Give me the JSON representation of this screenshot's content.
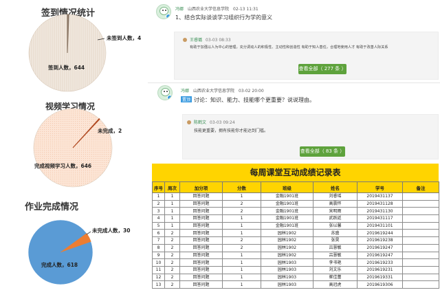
{
  "stats": {
    "sign_in": {
      "title": "签到情况统计",
      "signed_label": "签到人数，644",
      "unsigned_label": "未签到人数，4",
      "colors": {
        "fill": "#f1e9e0",
        "slice": "#8a7766"
      }
    },
    "video": {
      "title": "视频学习情况",
      "done_label": "完成视频学习人数，646",
      "undone_label": "未完成，2",
      "colors": {
        "fill": "#fce5d6",
        "slice": "#b14a22"
      }
    },
    "homework": {
      "title": "作业完成情况",
      "done_label": "完成人数，618",
      "undone_label": "未完成人数，30",
      "colors": {
        "fill": "#5a9bd5",
        "slice": "#ed7d31"
      }
    }
  },
  "chart_data": [
    {
      "type": "pie",
      "title": "签到情况统计",
      "categories": [
        "签到人数",
        "未签到人数"
      ],
      "values": [
        644,
        4
      ]
    },
    {
      "type": "pie",
      "title": "视频学习情况",
      "categories": [
        "完成视频学习人数",
        "未完成"
      ],
      "values": [
        646,
        2
      ]
    },
    {
      "type": "pie",
      "title": "作业完成情况",
      "categories": [
        "完成人数",
        "未完成人数"
      ],
      "values": [
        618,
        30
      ]
    }
  ],
  "discussion": {
    "post1": {
      "author": "冯娜",
      "school": "山西农业大学信息学院",
      "time": "02-13 11:31",
      "question": "1、结合实际谈谈学习组织行为学的意义",
      "reply": {
        "name": "王睿璐",
        "time": "03-03 08:33",
        "text": "有助于加强以人为中心的管理，充分调动人的积极性、主动性和创造性  有助于知人善任，合理地使用人才  有助于改善人际关系"
      },
      "view_all": "查看全部（ 277 条 ）"
    },
    "post2": {
      "author": "冯娜",
      "school": "山西农业大学信息学院",
      "time": "03-02 20:00",
      "tag": "置顶",
      "question": "讨论：知识、能力、技能哪个更重要？说说理由。",
      "reply": {
        "name": "陈鹤文",
        "time": "03-03 09:24",
        "text": "技能更重要，拥有技能你才能达到门槛。"
      },
      "view_all": "查看全部（ 83 条 ）"
    }
  },
  "table": {
    "title": "每周课堂互动成绩记录表",
    "headers": [
      "序号",
      "周次",
      "加分项",
      "分数",
      "班级",
      "姓名",
      "学号",
      "备注"
    ],
    "rows": [
      [
        "1",
        "1",
        "回答问题",
        "1",
        "金融1901班",
        "刘睿瑶",
        "2019431137",
        ""
      ],
      [
        "2",
        "1",
        "回答问题",
        "2",
        "金融1901班",
        "高震怀",
        "2019431128",
        ""
      ],
      [
        "3",
        "1",
        "回答问题",
        "2",
        "金融1901班",
        "宋明雨",
        "2019431130",
        ""
      ],
      [
        "4",
        "1",
        "回答问题",
        "1",
        "金融1901班",
        "武跃廷",
        "2019431117",
        ""
      ],
      [
        "5",
        "1",
        "回答问题",
        "1",
        "金融1901班",
        "张以馨",
        "2019431101",
        ""
      ],
      [
        "6",
        "2",
        "回答问题",
        "1",
        "园林1902",
        "苏盛",
        "2019619244",
        ""
      ],
      [
        "7",
        "2",
        "回答问题",
        "2",
        "园林1902",
        "张昊",
        "2019619238",
        ""
      ],
      [
        "8",
        "2",
        "回答问题",
        "2",
        "园林1902",
        "吕慧敏",
        "2019619247",
        ""
      ],
      [
        "9",
        "2",
        "回答问题",
        "1",
        "园林1902",
        "吕慧敏",
        "2019619247",
        ""
      ],
      [
        "10",
        "2",
        "回答问题",
        "1",
        "园林1903",
        "李书艳",
        "2019619233",
        ""
      ],
      [
        "11",
        "2",
        "回答问题",
        "1",
        "园林1903",
        "刘文乐",
        "2019619231",
        ""
      ],
      [
        "12",
        "2",
        "回答问题",
        "1",
        "园林1903",
        "崔佳蕾",
        "2019619331",
        ""
      ],
      [
        "13",
        "2",
        "回答问题",
        "1",
        "园林1903",
        "高冠虎",
        "2019619306",
        ""
      ]
    ]
  }
}
